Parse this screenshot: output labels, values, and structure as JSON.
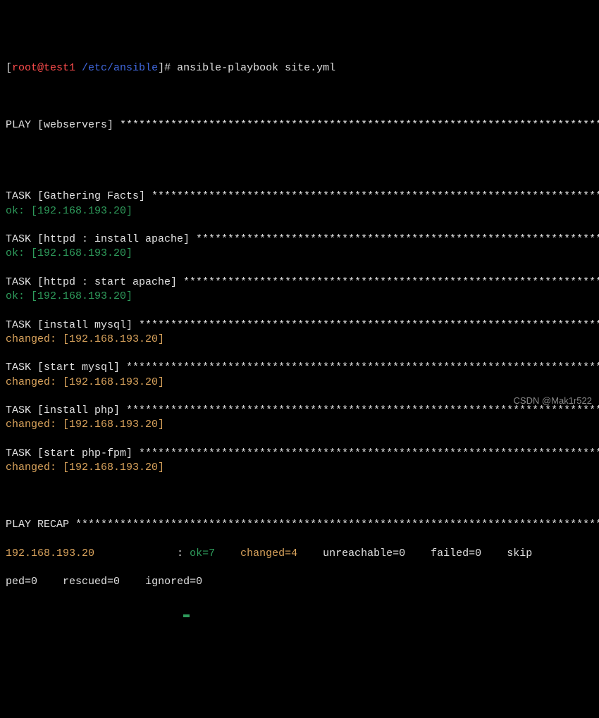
{
  "prompt": {
    "bracket_open": "[",
    "user": "root@test1",
    "pathspace": " ",
    "path": "/etc/ansible",
    "bracket_close": "]",
    "hash": "# ",
    "cmd": "ansible-playbook site.yml"
  },
  "play": {
    "label": "PLAY [webservers] ",
    "stars": "*****************************************************************************"
  },
  "tasks": [
    {
      "label": "TASK [Gathering Facts] ",
      "stars": "************************************************************************",
      "status_prefix": "ok",
      "status_suffix": ": [192.168.193.20]",
      "status_class": "green"
    },
    {
      "label": "TASK [httpd : install apache] ",
      "stars": "*****************************************************************",
      "status_prefix": "ok",
      "status_suffix": ": [192.168.193.20]",
      "status_class": "green"
    },
    {
      "label": "TASK [httpd : start apache] ",
      "stars": "*******************************************************************",
      "status_prefix": "ok",
      "status_suffix": ": [192.168.193.20]",
      "status_class": "green"
    },
    {
      "label": "TASK [install mysql] ",
      "stars": "**************************************************************************",
      "status_prefix": "changed",
      "status_suffix": ": [192.168.193.20]",
      "status_class": "yellow"
    },
    {
      "label": "TASK [start mysql] ",
      "stars": "****************************************************************************",
      "status_prefix": "changed",
      "status_suffix": ": [192.168.193.20]",
      "status_class": "yellow"
    },
    {
      "label": "TASK [install php] ",
      "stars": "****************************************************************************",
      "status_prefix": "changed",
      "status_suffix": ": [192.168.193.20]",
      "status_class": "yellow"
    },
    {
      "label": "TASK [start php-fpm] ",
      "stars": "**************************************************************************",
      "status_prefix": "changed",
      "status_suffix": ": [192.168.193.20]",
      "status_class": "yellow"
    }
  ],
  "recap": {
    "label": "PLAY RECAP ",
    "stars": "*************************************************************************************",
    "host": "192.168.193.20",
    "colon": "             : ",
    "ok": "ok=7",
    "sp1": "    ",
    "changed": "changed=4",
    "sp2": "    ",
    "unreachable": "unreachable=0",
    "sp3": "    ",
    "failed": "failed=0",
    "sp4": "    ",
    "skip1": "skip",
    "skip2": "ped=0",
    "sp5": "    ",
    "rescued": "rescued=0",
    "sp6": "    ",
    "ignored": "ignored=0"
  },
  "watermark": "CSDN @Mak1r522"
}
